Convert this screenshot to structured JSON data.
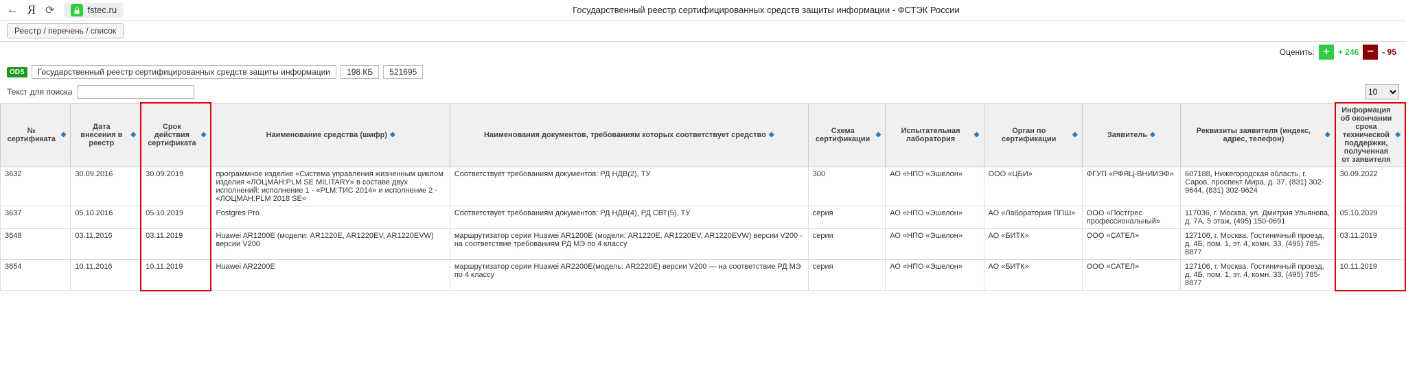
{
  "browser": {
    "url_host": "fstec.ru",
    "page_title": "Государственный реестр сертифицированных средств защиты информации - ФСТЭК России"
  },
  "sub_bar": {
    "breadcrumb_button": "Реестр / перечень / список"
  },
  "rating": {
    "label": "Оценить:",
    "up": "+ 246",
    "down": "- 95"
  },
  "meta": {
    "ods": "ODS",
    "file_title": "Государственный реестр сертифицированных средств защиты информации",
    "size": "198 КБ",
    "downloads": "521695"
  },
  "search": {
    "label": "Текст для поиска",
    "value": "",
    "page_size": "10"
  },
  "columns": [
    "№ сертификата",
    "Дата внесения в реестр",
    "Срок действия сертификата",
    "Наименование средства (шифр)",
    "Наименования документов, требованиям которых соответствует средство",
    "Схема сертификации",
    "Испытательная лаборатория",
    "Орган по сертификации",
    "Заявитель",
    "Реквизиты заявителя (индекс, адрес, телефон)",
    "Информация об окончании срока технической поддержки, полученная от заявителя"
  ],
  "rows": [
    {
      "num": "3632",
      "date_in": "30.09.2016",
      "valid_to": "30.09.2019",
      "name": "программное изделие «Система управления жизненным циклом изделия «ЛОЦМАН:PLM SE MILITARY» в составе двух исполнений: исполнение 1 - «PLM:ТИС 2014» и исполнение 2 - «ЛОЦМАН:PLM 2018 SE»",
      "docs": "Соответствует требованиям документов: РД НДВ(2), ТУ",
      "scheme": "300",
      "lab": "АО «НПО «Эшелон»",
      "organ": "ООО «ЦБИ»",
      "applicant": "ФГУП «РФЯЦ-ВНИИЭФ»",
      "requisites": "607188, Нижегородская область, г. Саров, проспект Мира, д. 37, (831) 302-9644, (831) 302-9624",
      "support_end": "30.09.2022"
    },
    {
      "num": "3637",
      "date_in": "05.10.2016",
      "valid_to": "05.10.2019",
      "name": "Postgres Pro",
      "docs": "Соответствует требованиям документов: РД НДВ(4), РД СВТ(5), ТУ",
      "scheme": "серия",
      "lab": "АО «НПО «Эшелон»",
      "organ": "АО «Лаборатория ППШ»",
      "applicant": "ООО «Постгрес профессиональный»",
      "requisites": "117036, г. Москва, ул. Дмитрия Ульянова, д. 7А, 5 этаж, (495) 150-0691",
      "support_end": "05.10.2029"
    },
    {
      "num": "3648",
      "date_in": "03.11.2016",
      "valid_to": "03.11.2019",
      "name": "Huawei AR1200E (модели: AR1220E, AR1220EV, AR1220EVW) версии V200",
      "docs": "маршрутизатор серии Huawei AR1200E (модели: AR1220E, AR1220EV, AR1220EVW) версии V200 - на соответствие требованиям РД МЭ по 4 классу",
      "scheme": "серия",
      "lab": "АО «НПО «Эшелон»",
      "organ": "АО «БИТК»",
      "applicant": "ООО «САТЕЛ»",
      "requisites": "127106, г. Москва, Гостиничный проезд, д. 4Б, пом. 1, эт. 4, комн. 33, (495) 785-8877",
      "support_end": "03.11.2019"
    },
    {
      "num": "3654",
      "date_in": "10.11.2016",
      "valid_to": "10.11.2019",
      "name": "Huawei AR2200E",
      "docs": "маршрутизатор серии Huawei AR2200E(модель: AR2220E) версии V200 — на соответствие РД МЭ по 4 классу",
      "scheme": "серия",
      "lab": "АО «НПО «Эшелон»",
      "organ": "АО «БИТК»",
      "applicant": "ООО «САТЕЛ»",
      "requisites": "127106, г. Москва, Гостиничный проезд, д. 4Б, пом. 1, эт. 4, комн. 33, (495) 785-8877",
      "support_end": "10.11.2019"
    }
  ]
}
